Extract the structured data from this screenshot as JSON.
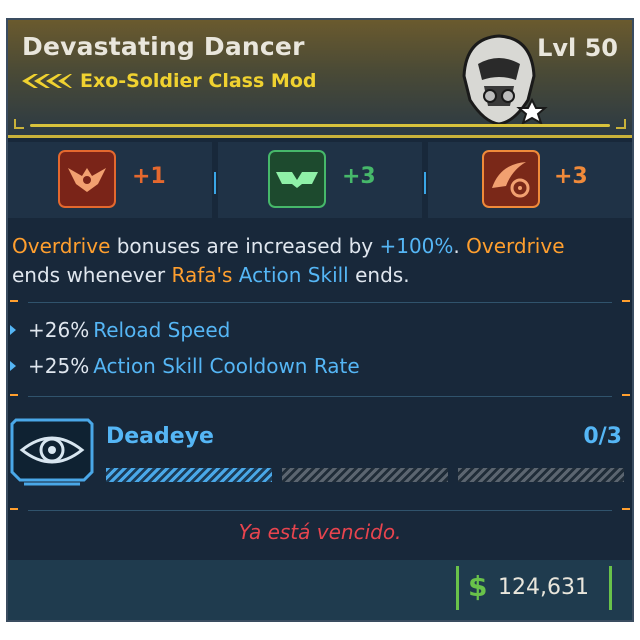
{
  "item": {
    "name": "Devastating Dancer",
    "type": "Exo-Soldier Class Mod",
    "level": "Lvl 50",
    "rarity_color": "#f0d230"
  },
  "skills": [
    {
      "bonus": "+1",
      "icon": "claw-emblem-icon",
      "color": "#e4682e"
    },
    {
      "bonus": "+3",
      "icon": "twin-blade-icon",
      "color": "#46b86a"
    },
    {
      "bonus": "+3",
      "icon": "crosshair-burst-icon",
      "color": "#f08a3a"
    }
  ],
  "description": {
    "seg1": "Overdrive",
    "seg2": " bonuses are increased by ",
    "seg3": "+100%",
    "seg4": ". ",
    "seg5": "Overdrive",
    "seg6": "ends whenever ",
    "seg7": "Rafa's",
    "seg8": " ",
    "seg9": "Action Skill",
    "seg10": " ends."
  },
  "stats": [
    {
      "value": "+26%",
      "label": "Reload Speed"
    },
    {
      "value": "+25%",
      "label": "Action Skill Cooldown Rate"
    }
  ],
  "perk": {
    "name": "Deadeye",
    "count": "0/3",
    "icon": "eye-target-icon",
    "pips_total": 3,
    "pips_filled": 1
  },
  "warning": "Ya está vencido.",
  "price": {
    "currency": "$",
    "value": "124,631"
  },
  "colors": {
    "accent_orange": "#ff9f2e",
    "accent_blue": "#55b6f5",
    "money_green": "#69c24a",
    "warning_red": "#e8444e"
  }
}
